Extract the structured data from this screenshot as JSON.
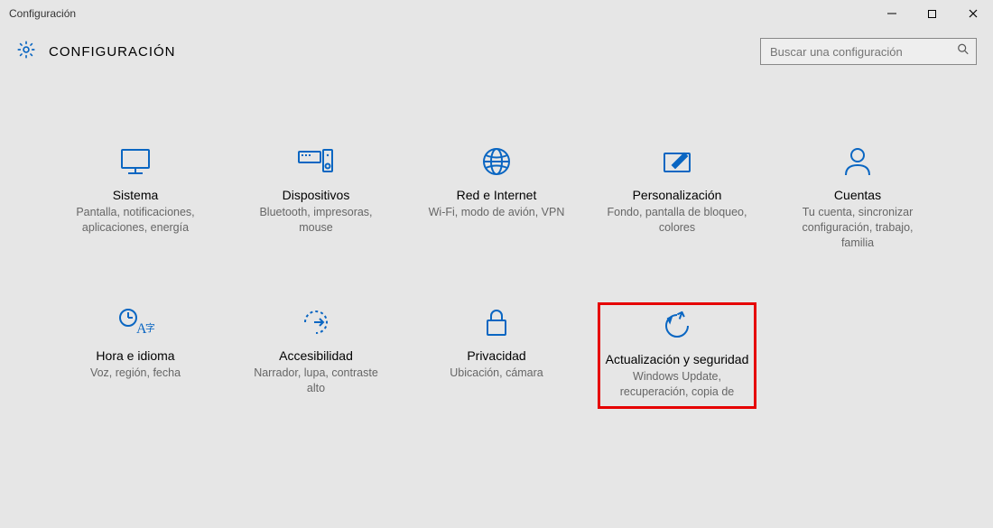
{
  "window": {
    "title": "Configuración"
  },
  "header": {
    "page_title": "CONFIGURACIÓN"
  },
  "search": {
    "placeholder": "Buscar una configuración"
  },
  "tiles": {
    "system": {
      "title": "Sistema",
      "sub": "Pantalla, notificaciones, aplicaciones, energía"
    },
    "devices": {
      "title": "Dispositivos",
      "sub": "Bluetooth, impresoras, mouse"
    },
    "network": {
      "title": "Red e Internet",
      "sub": "Wi-Fi, modo de avión, VPN"
    },
    "personalize": {
      "title": "Personalización",
      "sub": "Fondo, pantalla de bloqueo, colores"
    },
    "accounts": {
      "title": "Cuentas",
      "sub": "Tu cuenta, sincronizar configuración, trabajo, familia"
    },
    "time": {
      "title": "Hora e idioma",
      "sub": "Voz, región, fecha"
    },
    "access": {
      "title": "Accesibilidad",
      "sub": "Narrador, lupa, contraste alto"
    },
    "privacy": {
      "title": "Privacidad",
      "sub": "Ubicación, cámara"
    },
    "update": {
      "title": "Actualización y seguridad",
      "sub": "Windows Update, recuperación, copia de"
    }
  }
}
